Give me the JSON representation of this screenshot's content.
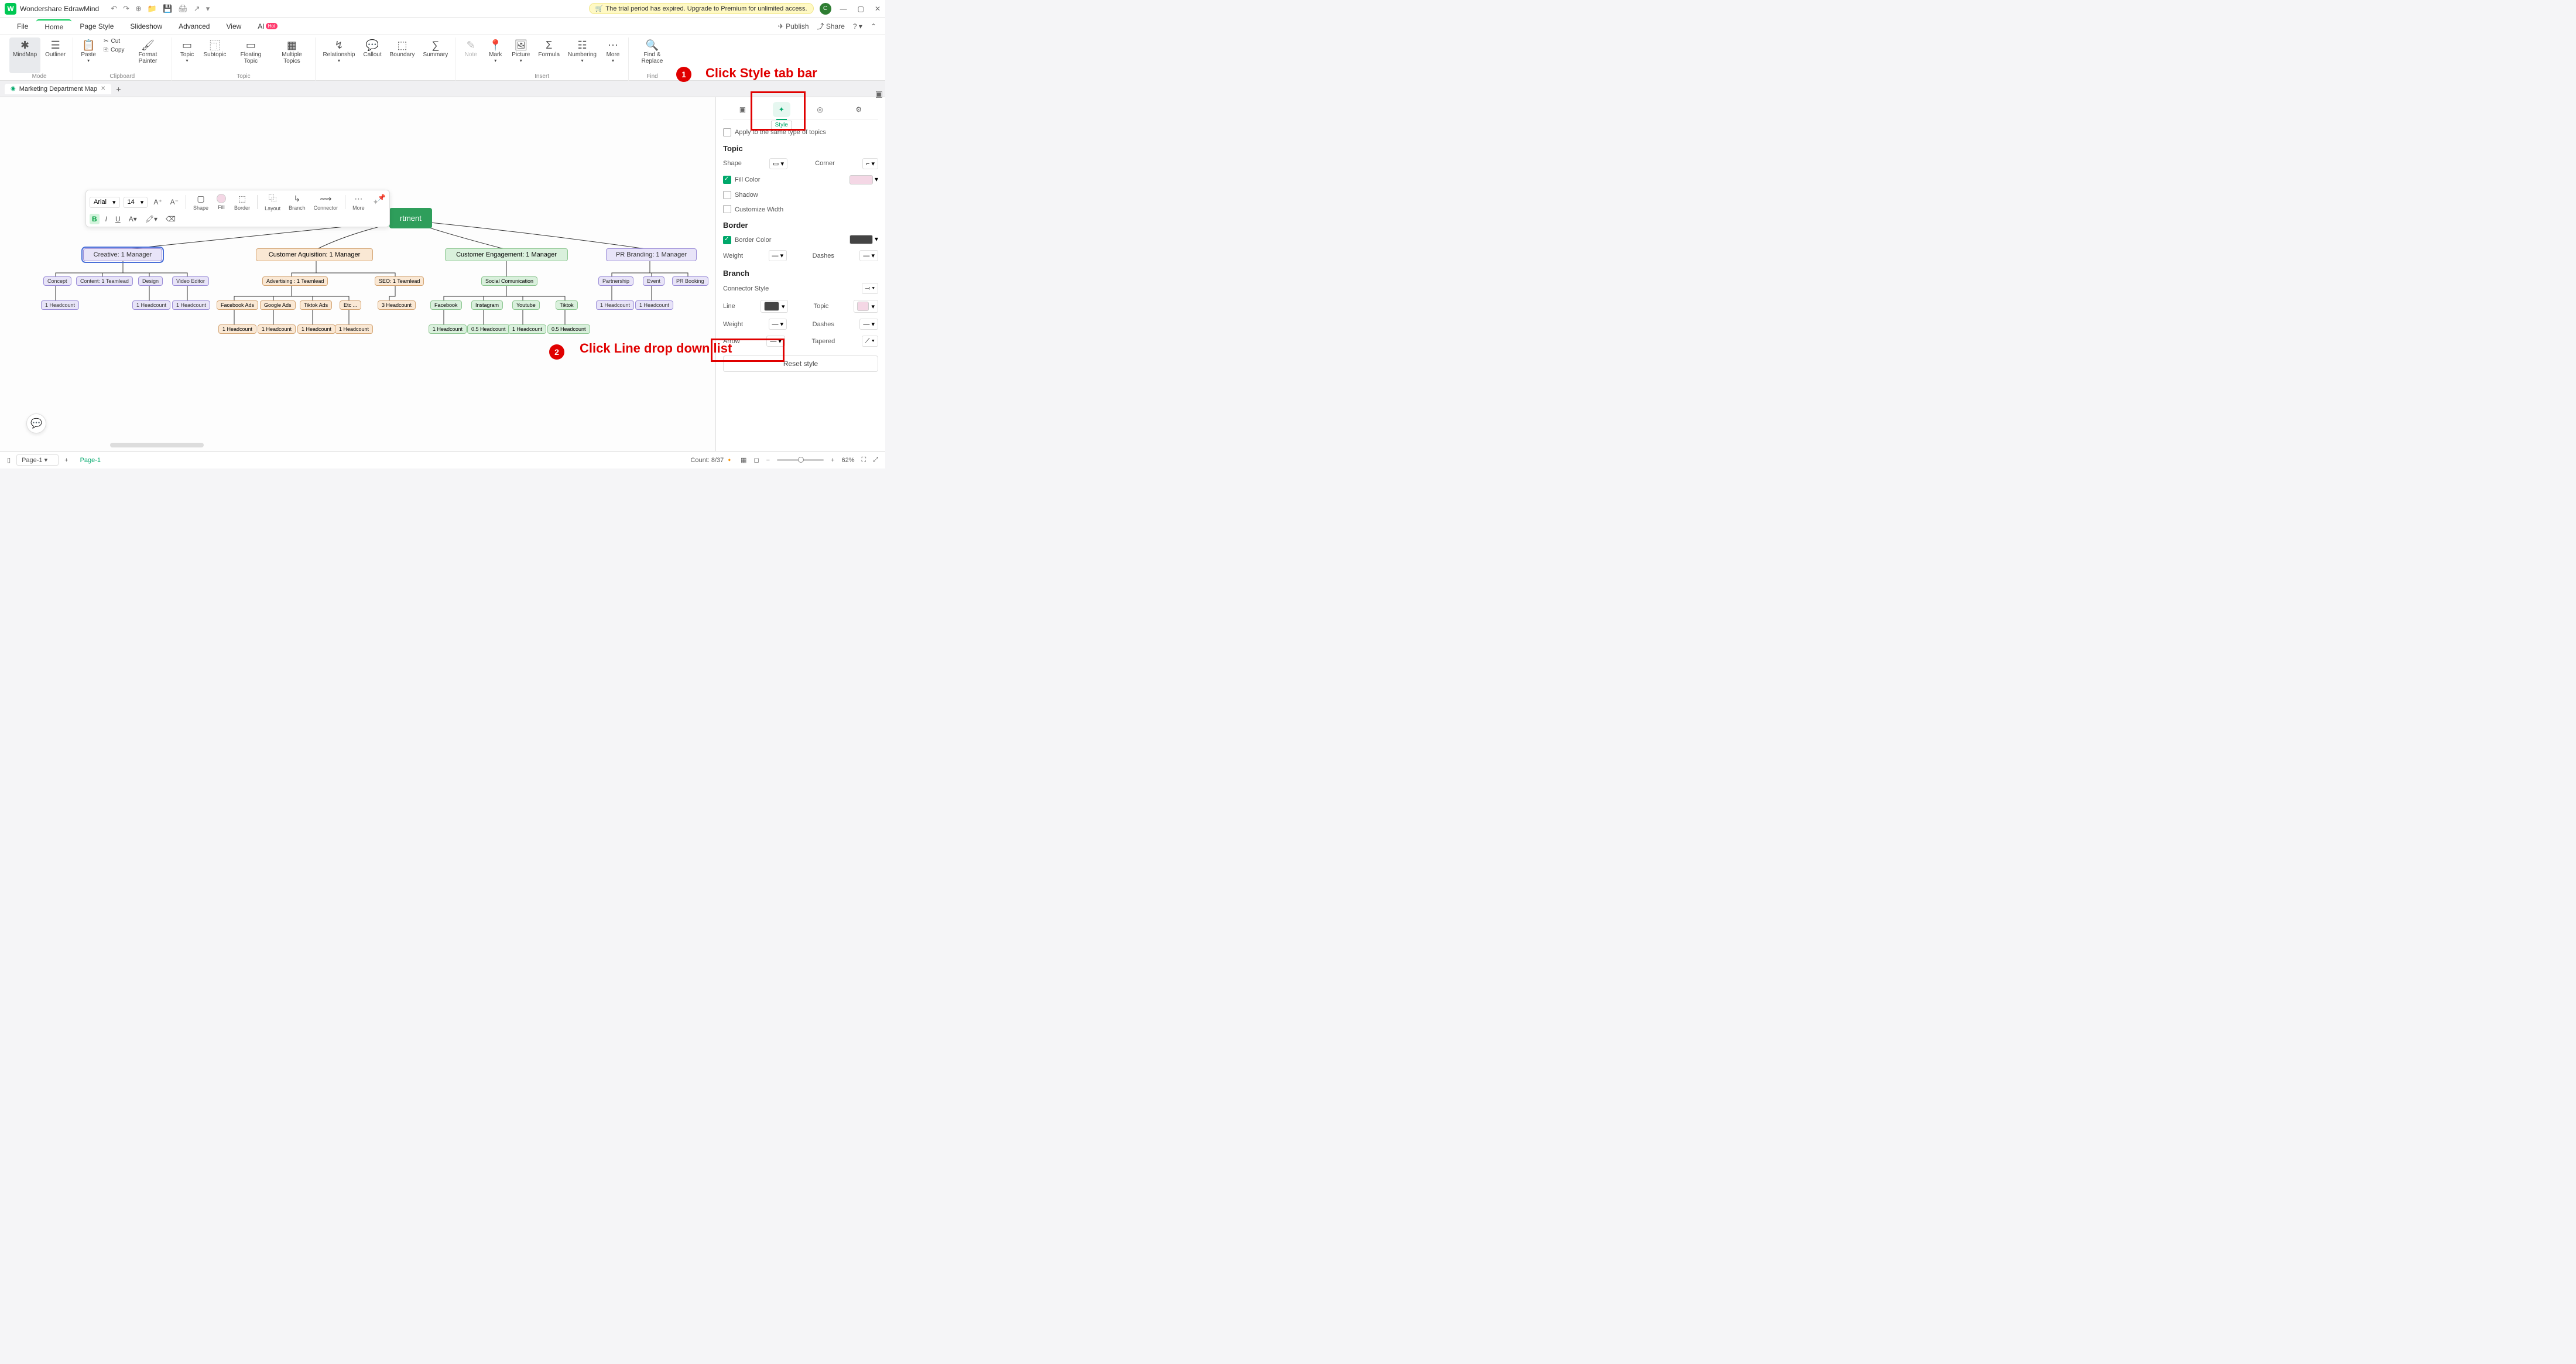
{
  "app": {
    "title": "Wondershare EdrawMind"
  },
  "trial": {
    "text": "The trial period has expired. Upgrade to Premium for unlimited access."
  },
  "user": {
    "initial": "C"
  },
  "menu": {
    "items": [
      "File",
      "Home",
      "Page Style",
      "Slideshow",
      "Advanced",
      "View"
    ],
    "ai": "AI",
    "hot": "Hot",
    "publish": "Publish",
    "share": "Share"
  },
  "ribbon": {
    "mode": "Mode",
    "mindmap": "MindMap",
    "outliner": "Outliner",
    "clipboard": "Clipboard",
    "paste": "Paste",
    "cut": "Cut",
    "copy": "Copy",
    "formatpainter": "Format Painter",
    "topic_group": "Topic",
    "topic": "Topic",
    "subtopic": "Subtopic",
    "floating": "Floating Topic",
    "multiple": "Multiple Topics",
    "relationship": "Relationship",
    "callout": "Callout",
    "boundary": "Boundary",
    "summary": "Summary",
    "insert": "Insert",
    "note": "Note",
    "mark": "Mark",
    "picture": "Picture",
    "formula": "Formula",
    "numbering": "Numbering",
    "more": "More",
    "find_group": "Find",
    "findreplace": "Find & Replace"
  },
  "doctab": {
    "name": "Marketing Department Map"
  },
  "float": {
    "font": "Arial",
    "size": "14",
    "shape": "Shape",
    "fill": "Fill",
    "border": "Border",
    "layout": "Layout",
    "branch": "Branch",
    "connector": "Connector",
    "more": "More"
  },
  "mm": {
    "root": "rtment",
    "l2_creative": "Creative: 1 Manager",
    "l2_customer_aq": "Customer Aquisition: 1 Manager",
    "l2_customer_eng": "Customer Engagement: 1 Manager",
    "l2_pr": "PR Branding: 1 Manager",
    "concept": "Concept",
    "content_lead": "Content: 1 Teamlead",
    "design": "Design",
    "video": "Video Editor",
    "advertising": "Advertising : 1 Teamlead",
    "seo": "SEO: 1 Teamlead",
    "social": "Social Comunication",
    "partnership": "Partnership",
    "event": "Event",
    "prbooking": "PR Booking",
    "fb_ads": "Facebook Ads",
    "google_ads": "Google Ads",
    "tiktok_ads": "Tiktok Ads",
    "etc": "Etc ...",
    "hc3": "3 Headcount",
    "facebook": "Facebook",
    "instagram": "Instagram",
    "youtube": "Youtube",
    "tiktok": "Tiktok",
    "hc1": "1 Headcount",
    "hc05": "0.5 Headcount"
  },
  "anno": {
    "step1": "Click Style tab bar",
    "step2": "Click Line drop down list"
  },
  "panel": {
    "style_tooltip": "Style",
    "apply_same": "Apply to the same type of topics",
    "topic": "Topic",
    "shape": "Shape",
    "corner": "Corner",
    "fillcolor": "Fill Color",
    "shadow": "Shadow",
    "customwidth": "Customize Width",
    "border": "Border",
    "bordercolor": "Border Color",
    "weight": "Weight",
    "dashes": "Dashes",
    "branch": "Branch",
    "connstyle": "Connector Style",
    "line": "Line",
    "topic_b": "Topic",
    "arrow": "Arrow",
    "tapered": "Tapered",
    "reset": "Reset style"
  },
  "status": {
    "page_sel": "Page-1",
    "page_tab": "Page-1",
    "count": "Count: 8/37",
    "zoom": "62%"
  }
}
